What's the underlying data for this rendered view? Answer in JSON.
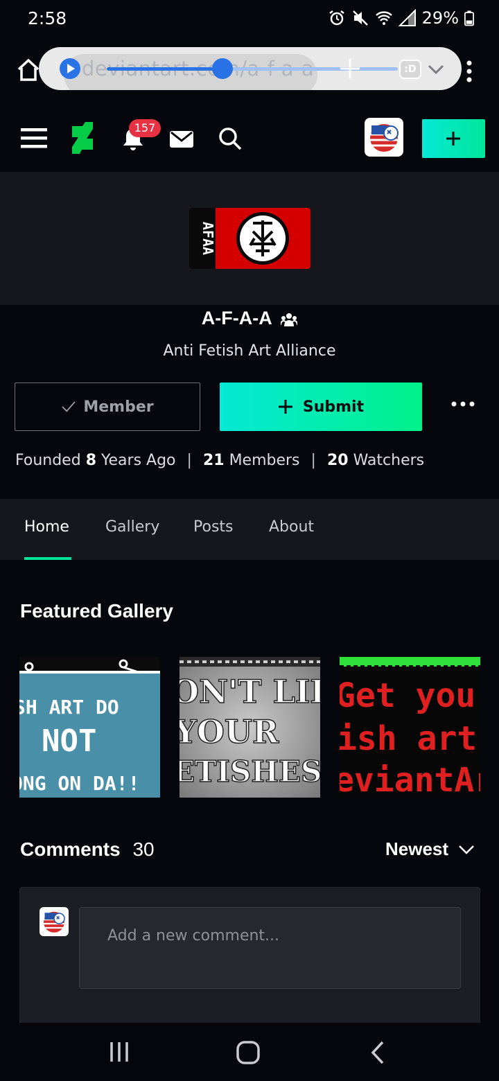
{
  "status_bar": {
    "time": "2:58",
    "battery": "29%"
  },
  "browser": {
    "url": "deviantart.com/a-f-a-a",
    "tabs_label": ":D"
  },
  "header": {
    "notification_count": "157"
  },
  "group": {
    "name": "A-F-A-A",
    "subtitle": "Anti Fetish Art Alliance",
    "logo_text": "AFAA"
  },
  "actions": {
    "member_label": "Member",
    "submit_label": "Submit"
  },
  "stats": {
    "founded_prefix": "Founded",
    "founded_value": "8",
    "founded_suffix": "Years Ago",
    "members_value": "21",
    "members_label": "Members",
    "watchers_value": "20",
    "watchers_label": "Watchers",
    "separator": "|"
  },
  "tabs": [
    {
      "label": "Home",
      "active": true
    },
    {
      "label": "Gallery",
      "active": false
    },
    {
      "label": "Posts",
      "active": false
    },
    {
      "label": "About",
      "active": false
    }
  ],
  "featured": {
    "title": "Featured Gallery",
    "thumbs": [
      {
        "lines": [
          "SH ART DO",
          "NOT",
          "ONG ON DA!!"
        ]
      },
      {
        "lines": [
          "ON'T LIK",
          "YOUR",
          "ETISHES"
        ]
      },
      {
        "lines": [
          "Get your",
          "ish art o",
          "eviantAr"
        ]
      }
    ]
  },
  "comments": {
    "title": "Comments",
    "count": "30",
    "sort_label": "Newest",
    "placeholder": "Add a new comment..."
  },
  "colors": {
    "accent": "#00e59b",
    "badge": "#e63243",
    "logo_red": "#d40000"
  }
}
